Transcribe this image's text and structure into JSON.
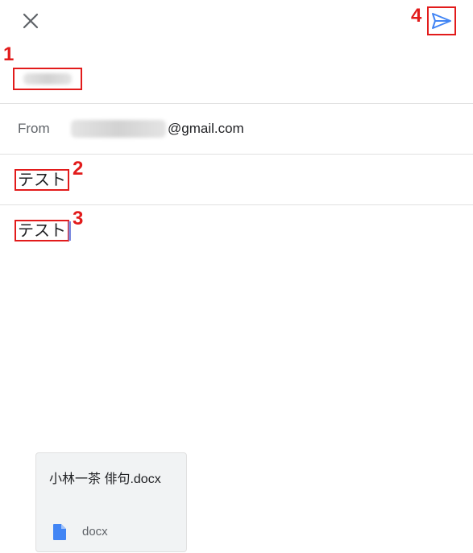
{
  "toolbar": {
    "close_icon": "close-icon",
    "send_icon": "send-icon",
    "send_color": "#4285f4"
  },
  "markers": {
    "m1": "1",
    "m2": "2",
    "m3": "3",
    "m4": "4",
    "color": "#e21b1b"
  },
  "from": {
    "label": "From",
    "domain": "@gmail.com"
  },
  "subject": {
    "value": "テスト"
  },
  "body": {
    "value": "テスト"
  },
  "attachment": {
    "name": "小林一茶 俳句.docx",
    "type": "docx",
    "icon": "document-icon",
    "icon_color": "#4285f4"
  }
}
